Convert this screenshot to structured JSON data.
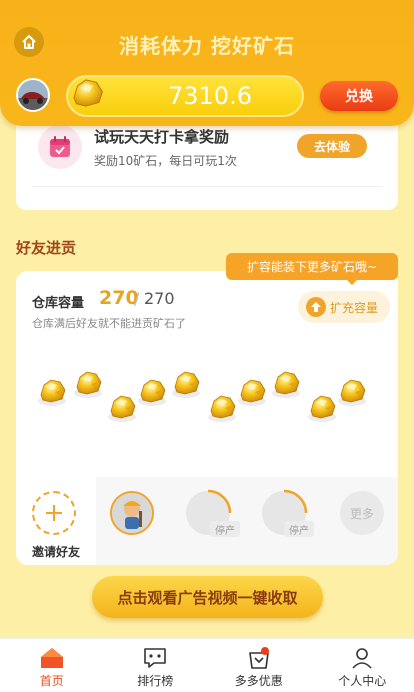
{
  "header": {
    "title": "消耗体力 挖好矿石",
    "balance": "7310.6",
    "exchange_label": "兑换"
  },
  "task": {
    "title": "试玩天天打卡拿奖励",
    "subtitle": "奖励10矿石，每日可玩1次",
    "button_label": "去体验"
  },
  "friends": {
    "section_title": "好友进贡",
    "tip": "扩容能装下更多矿石哦~",
    "capacity_label": "仓库容量",
    "capacity_current": "270",
    "capacity_sep": "/",
    "capacity_max": "270",
    "note": "仓库满后好友就不能进贡矿石了",
    "expand_label": "扩充容量",
    "invite_label": "邀请好友",
    "slots": [
      {
        "type": "worker"
      },
      {
        "type": "stopped",
        "tag": "停产"
      },
      {
        "type": "stopped",
        "tag": "停产"
      }
    ],
    "more_label": "更多"
  },
  "cta_label": "点击观看广告视频一键收取",
  "tabs": [
    {
      "label": "首页",
      "icon": "home-icon",
      "active": true
    },
    {
      "label": "排行榜",
      "icon": "ranking-icon",
      "active": false
    },
    {
      "label": "多多优惠",
      "icon": "coupon-bag-icon",
      "active": false
    },
    {
      "label": "个人中心",
      "icon": "profile-icon",
      "active": false
    }
  ],
  "colors": {
    "header": "#f8b41a",
    "background": "#fdf0a6",
    "accent": "#f0a52a",
    "active_tab": "#e8501f"
  }
}
